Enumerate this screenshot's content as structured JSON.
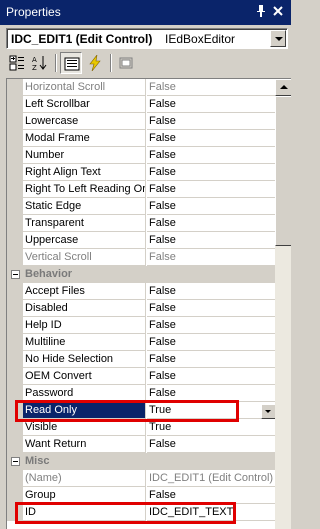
{
  "window": {
    "title": "Properties",
    "pin_icon": "pin-icon",
    "close_icon": "close-icon"
  },
  "object_combo": {
    "selected": "IDC_EDIT1 (Edit Control)",
    "type": "IEdBoxEditor"
  },
  "toolbar": {
    "buttons": [
      "categorized-icon",
      "alphabetical-icon",
      "properties-icon",
      "events-icon",
      "property-pages-icon"
    ]
  },
  "rows": [
    {
      "kind": "prop",
      "name": "Horizontal Scroll",
      "value": "False",
      "dim": true
    },
    {
      "kind": "prop",
      "name": "Left Scrollbar",
      "value": "False"
    },
    {
      "kind": "prop",
      "name": "Lowercase",
      "value": "False"
    },
    {
      "kind": "prop",
      "name": "Modal Frame",
      "value": "False"
    },
    {
      "kind": "prop",
      "name": "Number",
      "value": "False"
    },
    {
      "kind": "prop",
      "name": "Right Align Text",
      "value": "False"
    },
    {
      "kind": "prop",
      "name": "Right To Left Reading Or",
      "value": "False"
    },
    {
      "kind": "prop",
      "name": "Static Edge",
      "value": "False"
    },
    {
      "kind": "prop",
      "name": "Transparent",
      "value": "False"
    },
    {
      "kind": "prop",
      "name": "Uppercase",
      "value": "False"
    },
    {
      "kind": "prop",
      "name": "Vertical Scroll",
      "value": "False",
      "dim": true
    },
    {
      "kind": "cat",
      "name": "Behavior"
    },
    {
      "kind": "prop",
      "name": "Accept Files",
      "value": "False"
    },
    {
      "kind": "prop",
      "name": "Disabled",
      "value": "False"
    },
    {
      "kind": "prop",
      "name": "Help ID",
      "value": "False"
    },
    {
      "kind": "prop",
      "name": "Multiline",
      "value": "False"
    },
    {
      "kind": "prop",
      "name": "No Hide Selection",
      "value": "False"
    },
    {
      "kind": "prop",
      "name": "OEM Convert",
      "value": "False"
    },
    {
      "kind": "prop",
      "name": "Password",
      "value": "False"
    },
    {
      "kind": "prop",
      "name": "Read Only",
      "value": "True",
      "selected": true
    },
    {
      "kind": "prop",
      "name": "Visible",
      "value": "True"
    },
    {
      "kind": "prop",
      "name": "Want Return",
      "value": "False"
    },
    {
      "kind": "cat",
      "name": "Misc"
    },
    {
      "kind": "prop",
      "name": "(Name)",
      "value": "IDC_EDIT1 (Edit Control)",
      "dim": true
    },
    {
      "kind": "prop",
      "name": "Group",
      "value": "False"
    },
    {
      "kind": "prop",
      "name": "ID",
      "value": "IDC_EDIT_TEXT"
    }
  ],
  "colors": {
    "titlebar": "#0a246a",
    "selection": "#0a246a",
    "highlight_box": "#e00000",
    "panel": "#d4d0c8"
  }
}
